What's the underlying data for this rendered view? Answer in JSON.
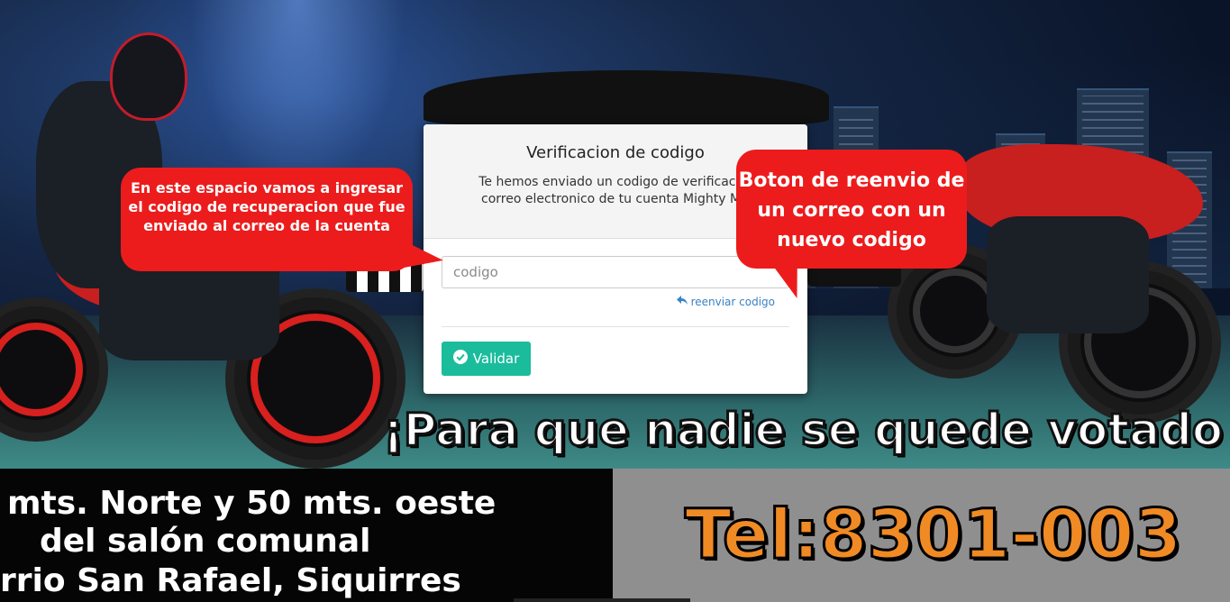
{
  "modal": {
    "title": "Verificacion de codigo",
    "message_line1": "Te hemos enviado un codigo de verificacion al",
    "message_line2": "correo electronico de tu cuenta Mighty Motos",
    "input_placeholder": "codigo",
    "resend_label": "reenviar codigo",
    "submit_label": "Validar",
    "accent_color": "#1abc9c",
    "link_color": "#3b82c4"
  },
  "annotations": {
    "input_note": "En este espacio vamos a ingresar el codigo de recuperacion que fue enviado al correo de la cuenta",
    "resend_note": "Boton de reenvio de un correo con un nuevo codigo",
    "bubble_color": "#ec1c1c"
  },
  "background": {
    "slogan": "¡Para que nadie se quede votado",
    "address_line1": "mts. Norte y 50 mts. oeste",
    "address_line2": "del salón comunal",
    "address_line3": "rrio San Rafael, Siquirres",
    "phone": "Tel:8301-003",
    "phone_color": "#f08a24"
  }
}
